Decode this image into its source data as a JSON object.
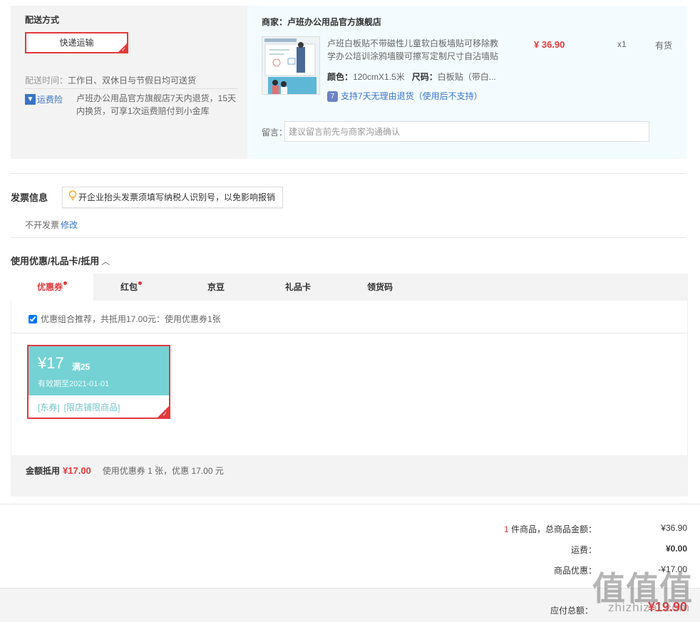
{
  "shipping": {
    "title": "配送方式",
    "method": "快递运输",
    "time_label": "配送时间：",
    "time_value": "工作日、双休日与节假日均可送货",
    "insurance_icon": "shield-icon",
    "insurance_label": "运费险",
    "insurance_desc": "卢班办公用品官方旗舰店7天内退货，15天内换货，可享1次运费赔付到小金库"
  },
  "order": {
    "seller_label": "商家：",
    "seller_name": "卢班办公用品官方旗舰店",
    "product_name": "卢班白板贴不带磁性儿童软白板墙贴可移除教学办公培训涂鸦墙膜可擦写定制尺寸自沾墙贴",
    "price": "¥ 36.90",
    "quantity": "x1",
    "stock": "有货",
    "color_label": "颜色：",
    "color_value": "120cmX1.5米",
    "size_label": "尺码：",
    "size_value": "白板贴（带白...",
    "return_icon": "7-day-return-icon",
    "return_text": "支持7天无理由退货（使用后不支持）",
    "remark_label": "留言：",
    "remark_placeholder": "建议留言前先与商家沟通确认"
  },
  "invoice": {
    "title": "发票信息",
    "tip_icon": "lightbulb-icon",
    "tip": "开企业抬头发票须填写纳税人识别号，以免影响报销",
    "value": "不开发票",
    "edit": "修改"
  },
  "coupons": {
    "title": "使用优惠/礼品卡/抵用",
    "tabs": [
      {
        "label": "优惠券",
        "dot": true,
        "active": true
      },
      {
        "label": "红包",
        "dot": true,
        "active": false
      },
      {
        "label": "京豆",
        "dot": false,
        "active": false
      },
      {
        "label": "礼品卡",
        "dot": false,
        "active": false
      },
      {
        "label": "领货码",
        "dot": false,
        "active": false
      }
    ],
    "combo_text": "优惠组合推荐，共抵用17.00元：使用优惠券1张",
    "combo_checked": true,
    "coupon": {
      "amount": "¥17",
      "condition": "满25",
      "expiry": "有效期至2021-01-01",
      "tag1": "[东券]",
      "tag2": "[限店铺限商品]",
      "accent_color": "#74d2d4"
    },
    "deduct_label": "金额抵用",
    "deduct_amount": "¥17.00",
    "deduct_desc": "使用优惠券 1 张，优惠 17.00 元"
  },
  "summary": {
    "count": "1",
    "count_label": "件商品，总商品金额：",
    "total": "¥36.90",
    "freight_label": "运费：",
    "freight": "¥0.00",
    "discount_label": "商品优惠：",
    "discount": "-¥17.00",
    "pay_label": "应付总额：",
    "pay_total": "¥19.90"
  },
  "watermark": {
    "main": "值值值",
    "sub": "zhizhizhi.com"
  },
  "colors": {
    "brand_red": "#e4393c",
    "link_blue": "#3a75c8"
  }
}
